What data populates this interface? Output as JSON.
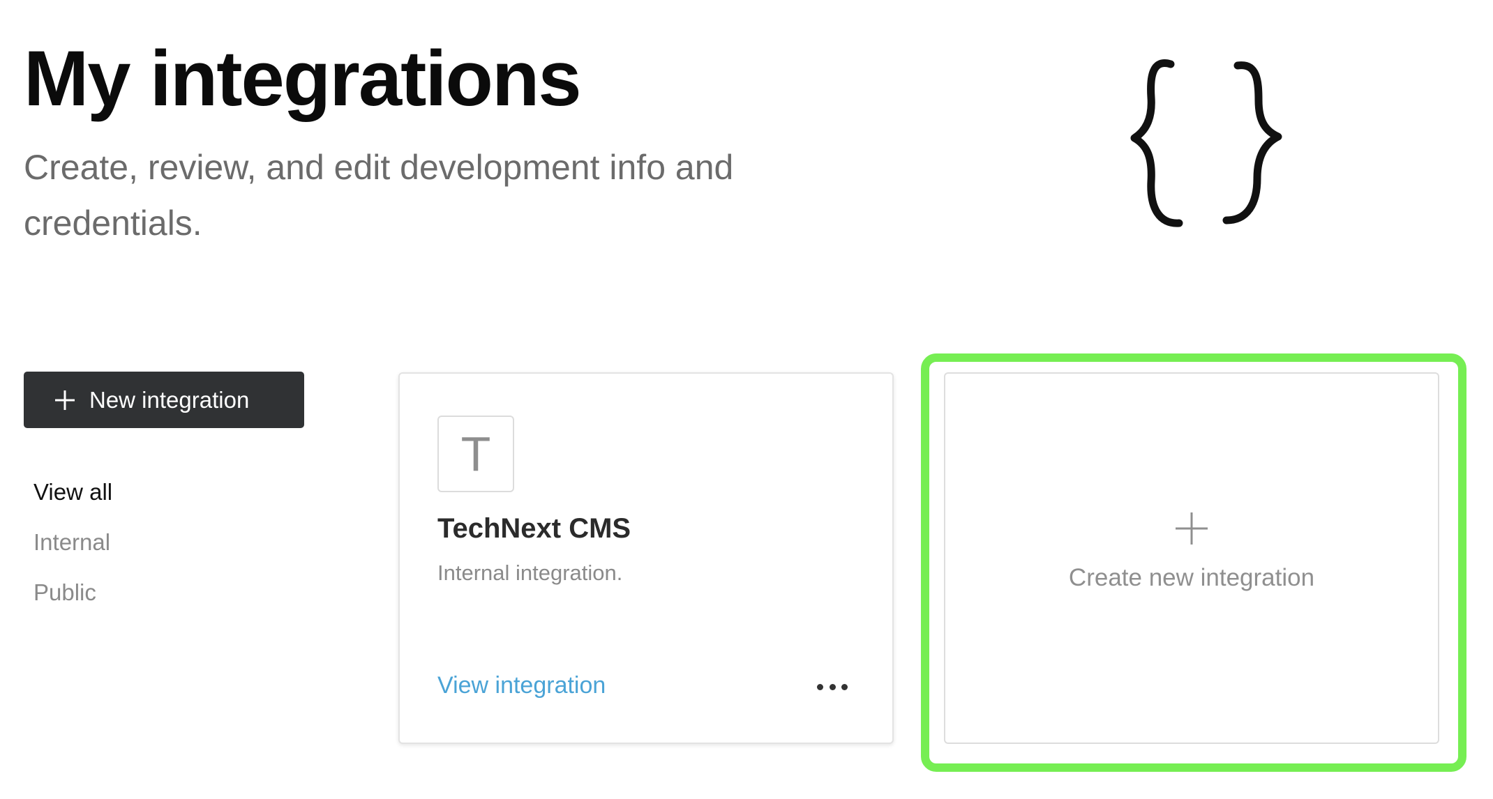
{
  "header": {
    "title": "My integrations",
    "subtitle": "Create, review, and edit development info and credentials."
  },
  "illustration": {
    "icon": "curly-braces-icon"
  },
  "sidebar": {
    "new_button": {
      "label": "New integration",
      "icon": "plus-icon"
    },
    "filters": [
      {
        "label": "View all",
        "active": true
      },
      {
        "label": "Internal",
        "active": false
      },
      {
        "label": "Public",
        "active": false
      }
    ]
  },
  "integrations": [
    {
      "avatar_letter": "T",
      "name": "TechNext CMS",
      "description": "Internal integration.",
      "link_label": "View integration",
      "menu_icon": "more-horizontal-icon"
    }
  ],
  "create_card": {
    "label": "Create new integration",
    "icon": "plus-icon"
  },
  "colors": {
    "button_bg": "#303234",
    "link": "#4aa3d6",
    "highlight": "#76ee53",
    "muted_text": "#8a8a8a"
  }
}
